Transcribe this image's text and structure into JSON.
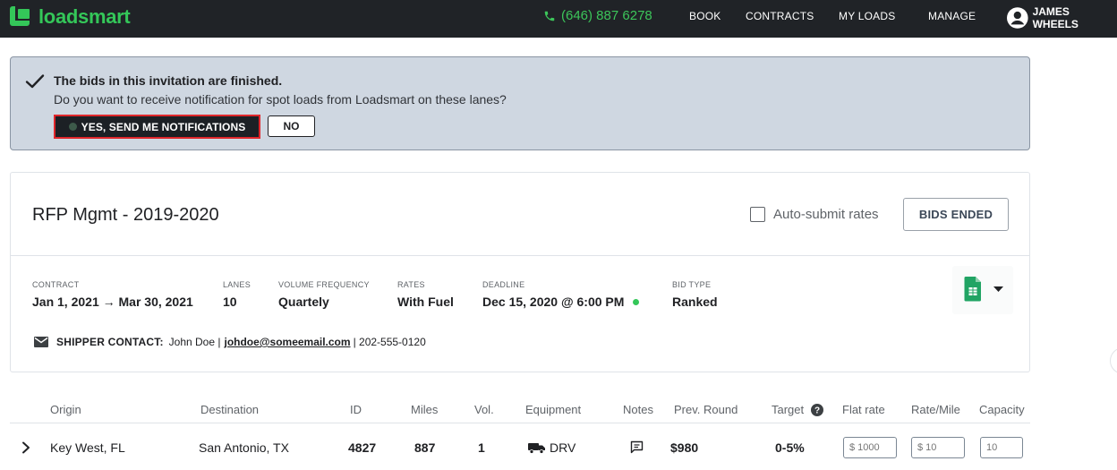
{
  "header": {
    "brand": "loadsmart",
    "phone": "(646) 887 6278",
    "nav": [
      "BOOK",
      "CONTRACTS",
      "MY LOADS",
      "MANAGE"
    ],
    "user": "JAMES WHEELS"
  },
  "banner": {
    "title": "The bids in this invitation are finished.",
    "subtitle": "Do you want to receive notification for spot loads from Loadsmart on these lanes?",
    "yes_label": "YES, SEND ME NOTIFICATIONS",
    "no_label": "NO"
  },
  "rfp": {
    "title": "RFP Mgmt - 2019-2020",
    "auto_submit_label": "Auto-submit rates",
    "bids_button": "BIDS ENDED",
    "meta": {
      "contract_label": "CONTRACT",
      "contract_value": "Jan 1, 2021 → Mar 30, 2021",
      "lanes_label": "LANES",
      "lanes_value": "10",
      "volume_label": "VOLUME FREQUENCY",
      "volume_value": "Quartely",
      "rates_label": "RATES",
      "rates_value": "With Fuel",
      "deadline_label": "DEADLINE",
      "deadline_value": "Dec 15, 2020 @ 6:00 PM",
      "bidtype_label": "BID TYPE",
      "bidtype_value": "Ranked"
    },
    "contact": {
      "label": "SHIPPER CONTACT:",
      "name": "John Doe |",
      "email": "johdoe@someemail.com",
      "phone": "| 202-555-0120"
    }
  },
  "table": {
    "headers": [
      "Origin",
      "Destination",
      "ID",
      "Miles",
      "Vol.",
      "Equipment",
      "Notes",
      "Prev. Round",
      "Target",
      "Flat rate",
      "Rate/Mile",
      "Capacity"
    ],
    "row": {
      "origin": "Key West, FL",
      "destination": "San Antonio, TX",
      "id": "4827",
      "miles": "887",
      "vol": "1",
      "equipment": "DRV",
      "prev_round": "$980",
      "target": "0-5%",
      "flat_rate_placeholder": "$ 1000",
      "rate_mile_placeholder": "$ 10",
      "capacity_placeholder": "10"
    }
  },
  "colors": {
    "topbar": "#202327",
    "brand_green": "#34c759",
    "banner_bg": "#cfd7e1",
    "highlight_border": "#e0262b"
  }
}
